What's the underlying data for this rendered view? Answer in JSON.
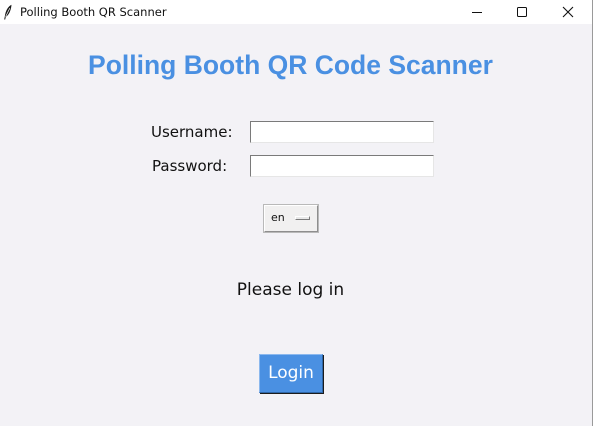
{
  "window": {
    "title": "Polling Booth QR Scanner",
    "app_icon": "feather-icon",
    "controls": {
      "minimize_icon": "minimize-icon",
      "maximize_icon": "maximize-icon",
      "close_icon": "close-icon"
    }
  },
  "main": {
    "heading": "Polling Booth QR Code Scanner",
    "heading_color": "#4a90e2",
    "username_label": "Username:",
    "username_value": "",
    "password_label": "Password:",
    "password_value": "",
    "language_selected": "en",
    "status_text": "Please log in",
    "login_label": "Login",
    "login_color": "#4a90e2"
  }
}
